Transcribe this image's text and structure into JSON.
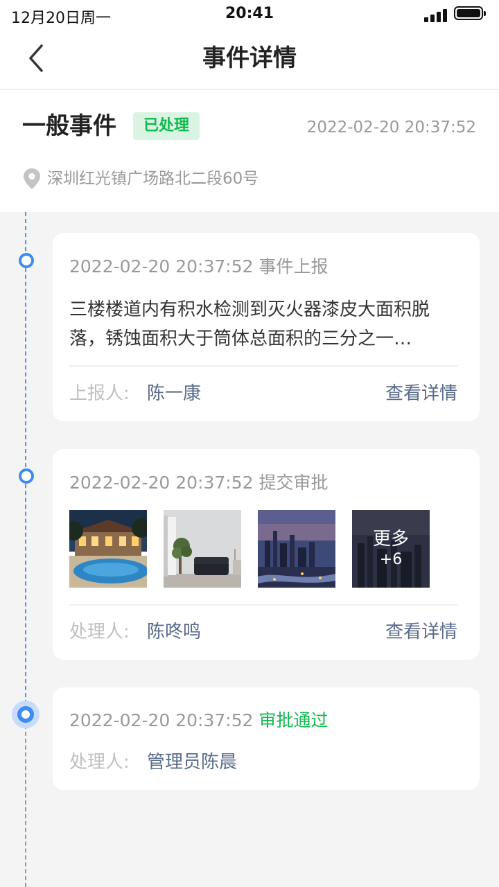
{
  "status_bar": {
    "date": "12月20日周一",
    "time": "20:41"
  },
  "nav": {
    "title": "事件详情"
  },
  "event": {
    "title": "一般事件",
    "status": "已处理",
    "time": "2022-02-20 20:37:52",
    "address": "深圳红光镇广场路北二段60号"
  },
  "timeline": [
    {
      "time": "2022-02-20 20:37:52",
      "action": "事件上报",
      "description": "三楼楼道内有积水检测到灭火器漆皮大面积脱落，锈蚀面积大于筒体总面积的三分之一…",
      "person_label": "上报人:",
      "person": "陈一康",
      "link": "查看详情"
    },
    {
      "time": "2022-02-20 20:37:52",
      "action": "提交审批",
      "images": [
        "pool-villa-photo",
        "living-room-photo",
        "city-skyline-photo",
        "city-night-photo"
      ],
      "more_label": "更多",
      "more_count": "+6",
      "person_label": "处理人:",
      "person": "陈咚鸣",
      "link": "查看详情"
    },
    {
      "time": "2022-02-20 20:37:52",
      "action": "审批通过",
      "person_label": "处理人:",
      "person": "管理员陈晨"
    }
  ],
  "colors": {
    "accent": "#3e8bf2",
    "success": "#11b84e",
    "link": "#5a6b8c",
    "badge_bg": "#d9f4e2"
  }
}
